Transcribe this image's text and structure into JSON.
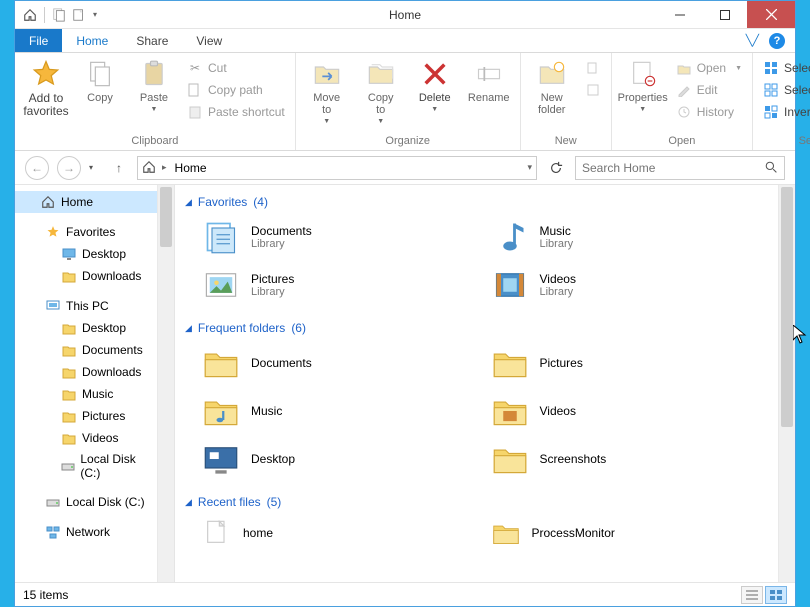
{
  "title": "Home",
  "qat": {
    "home_tip": "⌂",
    "props_tip": "📄",
    "new_tip": "📄"
  },
  "tabs": {
    "file": "File",
    "home": "Home",
    "share": "Share",
    "view": "View"
  },
  "ribbon": {
    "clipboard": {
      "label": "Clipboard",
      "add_favorites": "Add to\nfavorites",
      "copy": "Copy",
      "paste": "Paste",
      "cut": "Cut",
      "copy_path": "Copy path",
      "paste_shortcut": "Paste shortcut"
    },
    "organize": {
      "label": "Organize",
      "move_to": "Move\nto",
      "copy_to": "Copy\nto",
      "delete": "Delete",
      "rename": "Rename"
    },
    "new": {
      "label": "New",
      "new_folder": "New\nfolder"
    },
    "open": {
      "label": "Open",
      "properties": "Properties",
      "open": "Open",
      "edit": "Edit",
      "history": "History"
    },
    "select": {
      "label": "Select",
      "select_all": "Select all",
      "select_none": "Select none",
      "invert": "Invert selection"
    }
  },
  "breadcrumb": {
    "location": "Home"
  },
  "search": {
    "placeholder": "Search Home"
  },
  "tree": {
    "home": "Home",
    "favorites": "Favorites",
    "desktop": "Desktop",
    "downloads": "Downloads",
    "this_pc": "This PC",
    "documents": "Documents",
    "music": "Music",
    "pictures": "Pictures",
    "videos": "Videos",
    "local_disk": "Local Disk (C:)",
    "network": "Network"
  },
  "sections": {
    "favorites": {
      "title": "Favorites",
      "count": "(4)"
    },
    "frequent": {
      "title": "Frequent folders",
      "count": "(6)"
    },
    "recent": {
      "title": "Recent files",
      "count": "(5)"
    }
  },
  "favorites": [
    {
      "name": "Documents",
      "sub": "Library"
    },
    {
      "name": "Music",
      "sub": "Library"
    },
    {
      "name": "Pictures",
      "sub": "Library"
    },
    {
      "name": "Videos",
      "sub": "Library"
    }
  ],
  "frequent": [
    {
      "name": "Documents"
    },
    {
      "name": "Pictures"
    },
    {
      "name": "Music"
    },
    {
      "name": "Videos"
    },
    {
      "name": "Desktop"
    },
    {
      "name": "Screenshots"
    }
  ],
  "recent": [
    {
      "name": "home"
    },
    {
      "name": "ProcessMonitor"
    }
  ],
  "status": {
    "count": "15 items"
  }
}
